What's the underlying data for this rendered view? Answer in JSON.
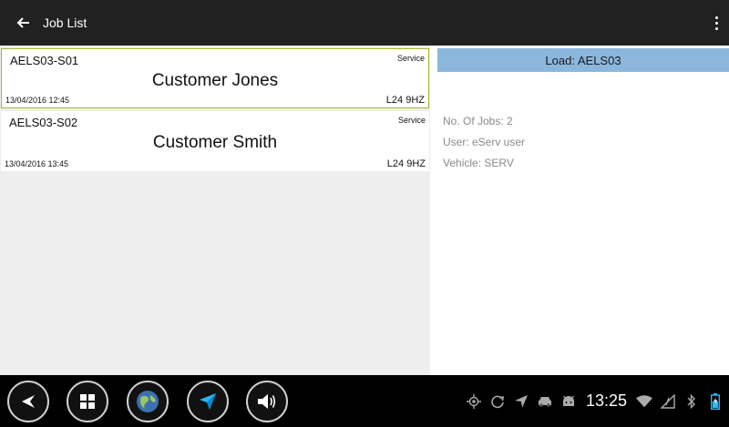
{
  "appbar": {
    "title": "Job List"
  },
  "jobs": [
    {
      "id": "AELS03-S01",
      "type": "Service",
      "customer": "Customer Jones",
      "date": "13/04/2016 12:45",
      "postcode": "L24 9HZ",
      "selected": true
    },
    {
      "id": "AELS03-S02",
      "type": "Service",
      "customer": "Customer Smith",
      "date": "13/04/2016 13:45",
      "postcode": "L24 9HZ",
      "selected": false
    }
  ],
  "detail": {
    "load": "Load: AELS03",
    "jobs_count": "No. Of Jobs: 2",
    "user": "User: eServ user",
    "vehicle": "Vehicle: SERV"
  },
  "status": {
    "time": "13:25"
  },
  "colors": {
    "appbar": "#212121",
    "selected_border": "#a8b430",
    "load_bar": "#8cb7dd",
    "list_bg": "#eeeeee"
  }
}
